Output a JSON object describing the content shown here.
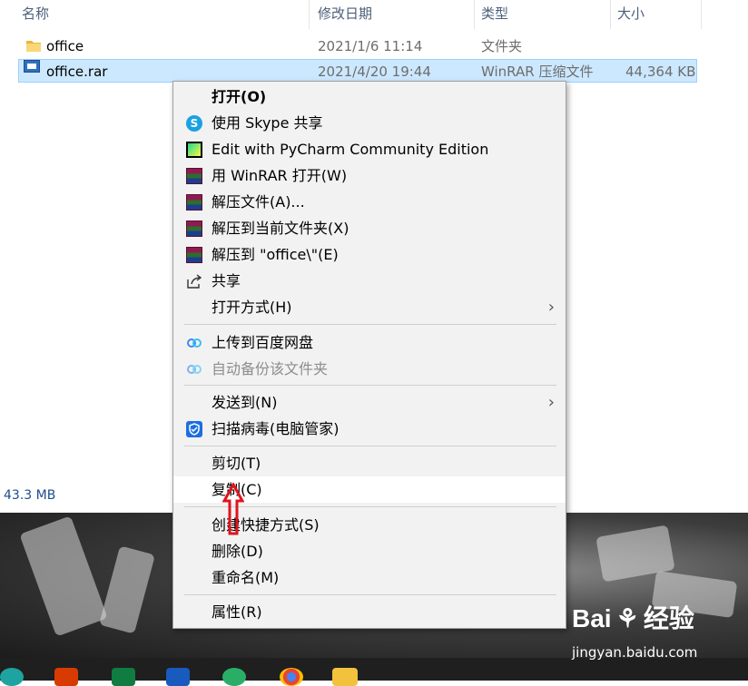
{
  "columns": {
    "name": "名称",
    "modified": "修改日期",
    "type": "类型",
    "size": "大小"
  },
  "files": [
    {
      "name": "office",
      "modified": "2021/1/6 11:14",
      "type": "文件夹",
      "size": "",
      "icon": "folder-icon"
    },
    {
      "name": "office.rar",
      "modified": "2021/4/20 19:44",
      "type": "WinRAR 压缩文件",
      "size": "44,364 KB",
      "icon": "rar-file-icon"
    }
  ],
  "status": {
    "selection_size": "43.3 MB"
  },
  "context_menu": {
    "open": "打开(O)",
    "skype_share": "使用 Skype 共享",
    "pycharm": "Edit with PyCharm Community Edition",
    "winrar_open": "用 WinRAR 打开(W)",
    "extract_files": "解压文件(A)...",
    "extract_here": "解压到当前文件夹(X)",
    "extract_to": "解压到 \"office\\\"(E)",
    "share": "共享",
    "open_with": "打开方式(H)",
    "upload_baidu": "上传到百度网盘",
    "auto_backup": "自动备份该文件夹",
    "send_to": "发送到(N)",
    "scan_virus": "扫描病毒(电脑管家)",
    "cut": "剪切(T)",
    "copy": "复制(C)",
    "create_shortcut": "创建快捷方式(S)",
    "delete": "删除(D)",
    "rename": "重命名(M)",
    "properties": "属性(R)"
  },
  "watermark": {
    "brand": "Bai",
    "brand2": "经验",
    "url": "jingyan.baidu.com"
  },
  "colors": {
    "selection": "#cce8ff",
    "accent": "#0078d7",
    "arrow": "#e0141e"
  }
}
